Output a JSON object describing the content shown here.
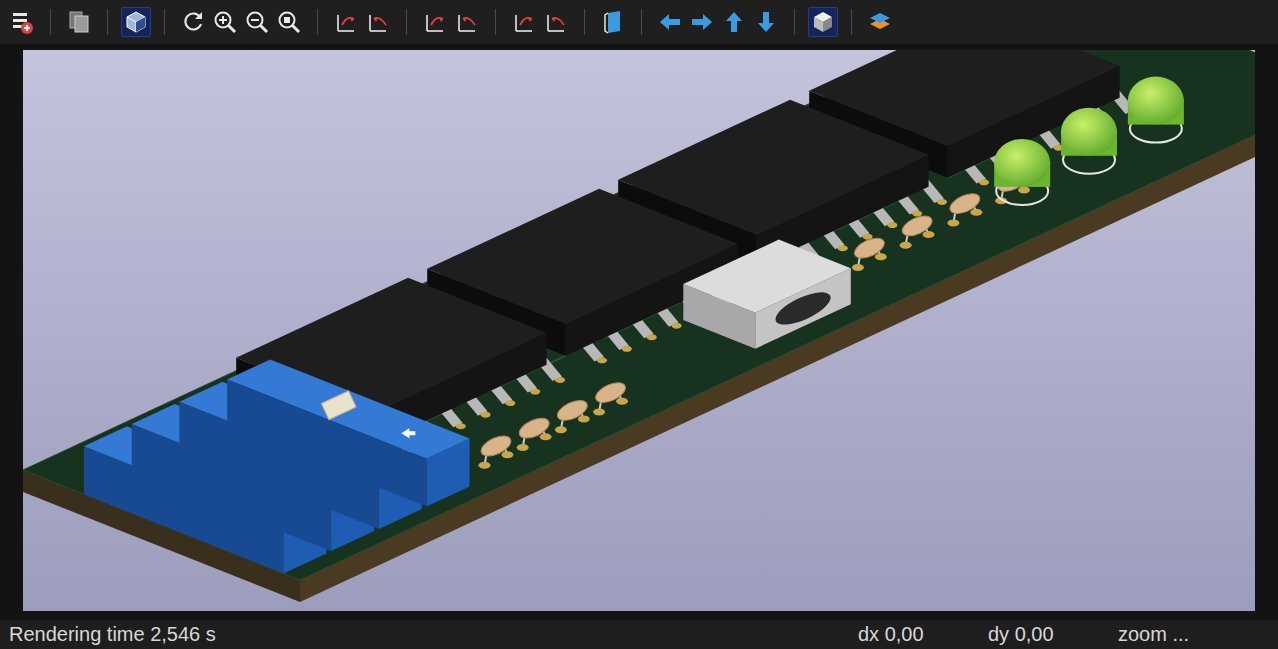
{
  "toolbar": {
    "groups": [
      [
        {
          "kind": "export",
          "selected": false
        }
      ],
      [
        {
          "kind": "copy",
          "selected": false
        }
      ],
      [
        {
          "kind": "raytrace",
          "selected": true
        }
      ],
      [
        {
          "kind": "reload",
          "selected": false
        },
        {
          "kind": "zoomin",
          "selected": false
        },
        {
          "kind": "zoomout",
          "selected": false
        },
        {
          "kind": "zoomfit",
          "selected": false
        }
      ],
      [
        {
          "kind": "rotxcw",
          "selected": false
        },
        {
          "kind": "rotxccw",
          "selected": false
        }
      ],
      [
        {
          "kind": "rotycw",
          "selected": false
        },
        {
          "kind": "rotyccw",
          "selected": false
        }
      ],
      [
        {
          "kind": "rotzcw",
          "selected": false
        },
        {
          "kind": "rotzccw",
          "selected": false
        }
      ],
      [
        {
          "kind": "flip",
          "selected": false
        }
      ],
      [
        {
          "kind": "left",
          "selected": false
        },
        {
          "kind": "right",
          "selected": false
        },
        {
          "kind": "up",
          "selected": false
        },
        {
          "kind": "down",
          "selected": false
        }
      ],
      [
        {
          "kind": "ortho",
          "selected": true
        }
      ],
      [
        {
          "kind": "layers",
          "selected": false
        }
      ]
    ]
  },
  "status_bar": {
    "rendering_time": "Rendering time 2,546 s",
    "dx": "dx 0,00",
    "dy": "dy 0,00",
    "zoom": "zoom ..."
  }
}
